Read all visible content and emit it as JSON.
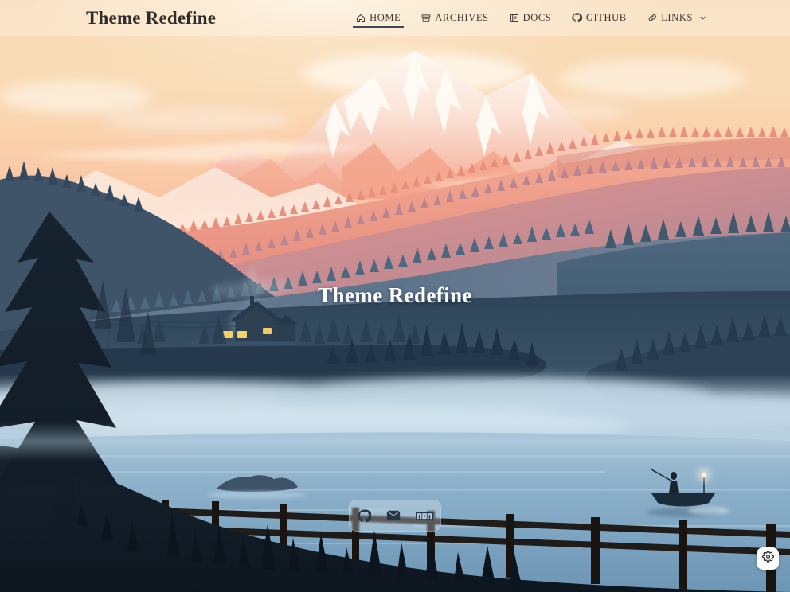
{
  "header": {
    "brand": "Theme Redefine",
    "nav": [
      {
        "label": "HOME",
        "icon": "home-icon",
        "active": true,
        "chevron": false
      },
      {
        "label": "ARCHIVES",
        "icon": "archive-icon",
        "active": false,
        "chevron": false
      },
      {
        "label": "DOCS",
        "icon": "book-icon",
        "active": false,
        "chevron": false
      },
      {
        "label": "GITHUB",
        "icon": "github-icon",
        "active": false,
        "chevron": false
      },
      {
        "label": "LINKS",
        "icon": "link-icon",
        "active": false,
        "chevron": true
      }
    ]
  },
  "hero": {
    "title": "Theme Redefine"
  },
  "social": {
    "items": [
      {
        "name": "github-icon",
        "label": "GitHub"
      },
      {
        "name": "email-icon",
        "label": "Email"
      },
      {
        "name": "npm-icon",
        "label": "npm"
      }
    ]
  },
  "settings": {
    "icon": "gear-icon",
    "label": "Settings"
  },
  "scene": {
    "description": "Sunset mountain landscape with misty lake, cabin, fisherman in boat and wooden fence",
    "colors": {
      "sky_top": "#f6d6ab",
      "sky_mid": "#f8c9a4",
      "sky_glow": "#fdf0dc",
      "peak_snow": "#fdf3ea",
      "peak_shadow": "#f6a58d",
      "ridge_far": "#f2a58f",
      "ridge_mid": "#d98f89",
      "ridge_near": "#9a8195",
      "hill_blue": "#5d7186",
      "hill_dark": "#3f5468",
      "fog": "#b9cfdd",
      "water": "#7ba2bd",
      "foreground": "#141e27",
      "header_overlay": "#ffffff",
      "accent_underline": "#3c4a5c",
      "title_text": "#ffffff",
      "brand_text": "#2e2b29"
    }
  }
}
